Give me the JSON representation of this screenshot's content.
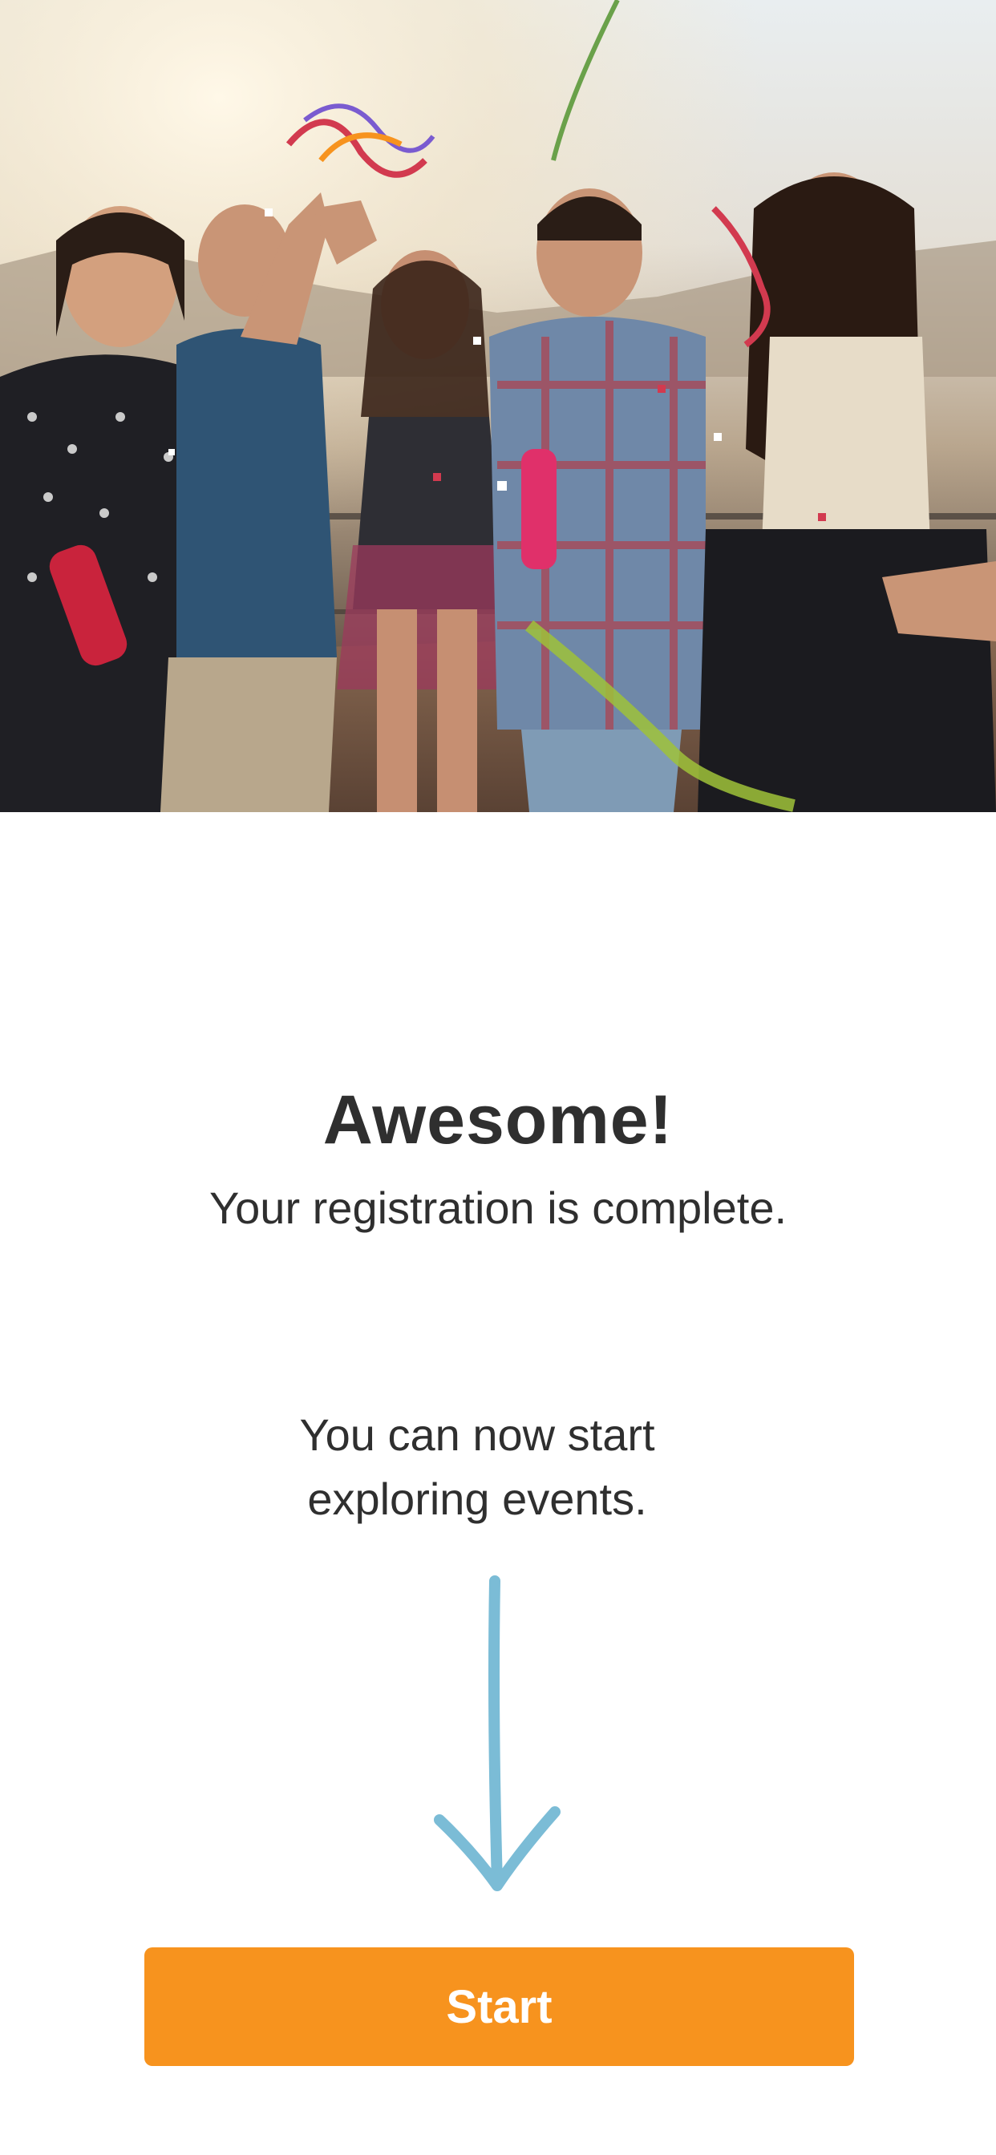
{
  "hero": {
    "image": "party-confetti-photo",
    "accent_colors": [
      "#f7931e",
      "#d23a4f",
      "#7bbcd6",
      "#9fc23a"
    ]
  },
  "content": {
    "headline": "Awesome!",
    "subheadline": "Your registration is complete.",
    "body_line1": "You can now start",
    "body_line2": "exploring events.",
    "arrow_icon": "arrow-down-icon",
    "arrow_color": "#7bbcd6"
  },
  "actions": {
    "start_label": "Start",
    "start_color": "#f7931e"
  }
}
